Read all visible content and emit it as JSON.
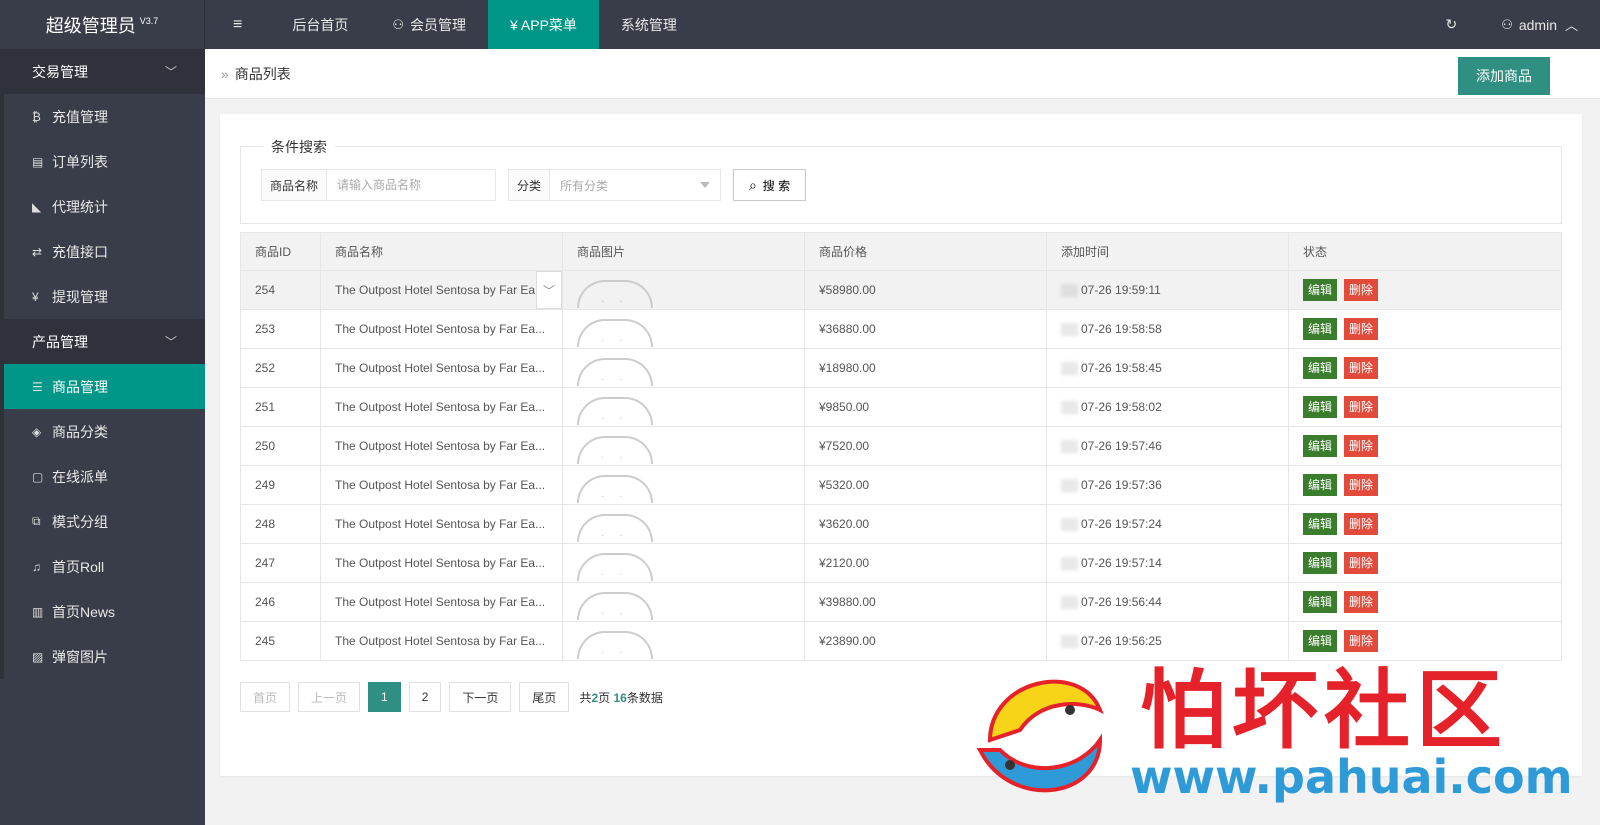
{
  "app": {
    "title": "超级管理员",
    "version": "V3.7"
  },
  "topnav": {
    "toggle_icon": "≡",
    "items": [
      {
        "label": "后台首页"
      },
      {
        "label": "会员管理",
        "icon": "user-icon"
      },
      {
        "label": "¥ APP菜单",
        "active": true
      },
      {
        "label": "系统管理"
      }
    ],
    "refresh_icon": "↻",
    "user": "admin"
  },
  "sidebar": {
    "groups": [
      {
        "label": "交易管理",
        "items": [
          {
            "label": "充值管理",
            "icon": "bitcoin-icon",
            "glyph": "₿"
          },
          {
            "label": "订单列表",
            "icon": "list-icon",
            "glyph": "▤"
          },
          {
            "label": "代理统计",
            "icon": "chart-icon",
            "glyph": "◣"
          },
          {
            "label": "充值接口",
            "icon": "exchange-icon",
            "glyph": "⇄"
          },
          {
            "label": "提现管理",
            "icon": "yen-icon",
            "glyph": "¥"
          }
        ]
      },
      {
        "label": "产品管理",
        "items": [
          {
            "label": "商品管理",
            "icon": "align-icon",
            "glyph": "☰",
            "active": true
          },
          {
            "label": "商品分类",
            "icon": "layers-icon",
            "glyph": "◈"
          },
          {
            "label": "在线派单",
            "icon": "note-icon",
            "glyph": "▢"
          },
          {
            "label": "模式分组",
            "icon": "screens-icon",
            "glyph": "⧉"
          },
          {
            "label": "首页Roll",
            "icon": "bell-icon",
            "glyph": "♫"
          },
          {
            "label": "首页News",
            "icon": "news-icon",
            "glyph": "▥"
          },
          {
            "label": "弹窗图片",
            "icon": "image-icon",
            "glyph": "▨"
          }
        ]
      }
    ]
  },
  "breadcrumb": {
    "sep": "»",
    "current": "商品列表"
  },
  "toolbar": {
    "add_label": "添加商品"
  },
  "search": {
    "legend": "条件搜索",
    "name_label": "商品名称",
    "name_placeholder": "请输入商品名称",
    "category_label": "分类",
    "category_value": "所有分类",
    "search_label": "搜 索"
  },
  "table": {
    "headers": [
      "商品ID",
      "商品名称",
      "商品图片",
      "商品价格",
      "添加时间",
      "状态"
    ],
    "edit_label": "编辑",
    "delete_label": "删除",
    "rows": [
      {
        "id": "254",
        "name": "The Outpost Hotel Sentosa by Far Ea...",
        "price": "¥58980.00",
        "time": "07-26 19:59:11"
      },
      {
        "id": "253",
        "name": "The Outpost Hotel Sentosa by Far Ea...",
        "price": "¥36880.00",
        "time": "07-26 19:58:58"
      },
      {
        "id": "252",
        "name": "The Outpost Hotel Sentosa by Far Ea...",
        "price": "¥18980.00",
        "time": "07-26 19:58:45"
      },
      {
        "id": "251",
        "name": "The Outpost Hotel Sentosa by Far Ea...",
        "price": "¥9850.00",
        "time": "07-26 19:58:02"
      },
      {
        "id": "250",
        "name": "The Outpost Hotel Sentosa by Far Ea...",
        "price": "¥7520.00",
        "time": "07-26 19:57:46"
      },
      {
        "id": "249",
        "name": "The Outpost Hotel Sentosa by Far Ea...",
        "price": "¥5320.00",
        "time": "07-26 19:57:36"
      },
      {
        "id": "248",
        "name": "The Outpost Hotel Sentosa by Far Ea...",
        "price": "¥3620.00",
        "time": "07-26 19:57:24"
      },
      {
        "id": "247",
        "name": "The Outpost Hotel Sentosa by Far Ea...",
        "price": "¥2120.00",
        "time": "07-26 19:57:14"
      },
      {
        "id": "246",
        "name": "The Outpost Hotel Sentosa by Far Ea...",
        "price": "¥39880.00",
        "time": "07-26 19:56:44"
      },
      {
        "id": "245",
        "name": "The Outpost Hotel Sentosa by Far Ea...",
        "price": "¥23890.00",
        "time": "07-26 19:56:25"
      }
    ]
  },
  "pager": {
    "first": "首页",
    "prev": "上一页",
    "pages": [
      "1",
      "2"
    ],
    "next": "下一页",
    "last": "尾页",
    "info_prefix": "共",
    "total_pages": "2",
    "info_mid": "页 ",
    "total_items": "16",
    "info_suffix": "条数据"
  },
  "watermark": {
    "text": "怕坏社区",
    "url": "www.pahuai.com"
  },
  "colors": {
    "accent": "#009688",
    "nav_bg": "#393d49",
    "edit": "#3a7d2c",
    "delete": "#e24a3b"
  }
}
